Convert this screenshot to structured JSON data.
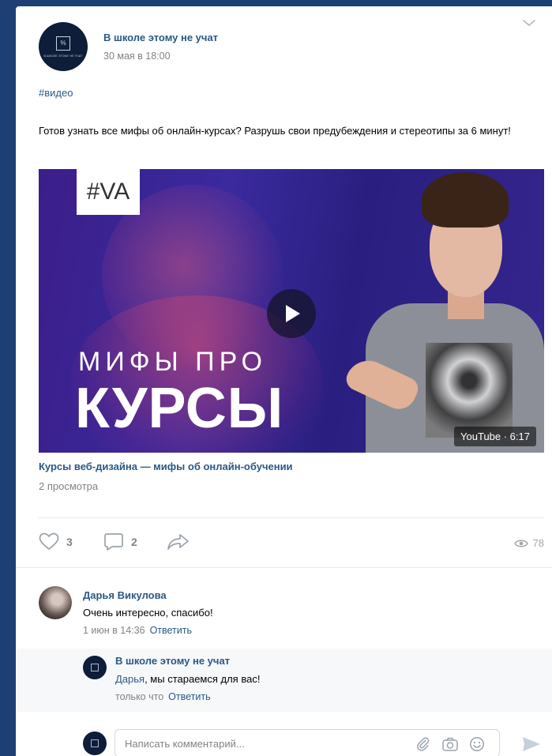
{
  "post": {
    "author": "В школе этому не учат",
    "date": "30 мая в 18:00",
    "avatar_logo": "%",
    "avatar_text": "В школе этому не учат",
    "hashtag": "#видео",
    "text": "Готов узнать все мифы об онлайн-курсах? Разрушь свои предубеждения и стереотипы за 6 минут!",
    "video": {
      "badge": "#VA",
      "line1": "МИФЫ ПРО",
      "line2": "КУРСЫ",
      "source_duration": "YouTube · 6:17",
      "title": "Курсы веб-дизайна — мифы об онлайн-обучении",
      "views": "2 просмотра"
    },
    "actions": {
      "likes": "3",
      "comments": "2",
      "views": "78"
    }
  },
  "comments": [
    {
      "name": "Дарья Викулова",
      "text": "Очень интересно, спасибо!",
      "time": "1 июн в 14:36",
      "reply_label": "Ответить"
    }
  ],
  "reply": {
    "name": "В школе этому не учат",
    "mention": "Дарья",
    "text": ", мы стараемся для вас!",
    "time": "только что",
    "reply_label": "Ответить"
  },
  "comment_input": {
    "placeholder": "Написать комментарий..."
  },
  "colors": {
    "background": "#1e3f73",
    "link": "#2a5885",
    "meta": "#828282"
  },
  "icons": [
    "chevron-down-icon",
    "play-icon",
    "heart-icon",
    "comment-icon",
    "share-icon",
    "eye-icon",
    "paperclip-icon",
    "camera-icon",
    "smile-icon",
    "send-icon"
  ]
}
